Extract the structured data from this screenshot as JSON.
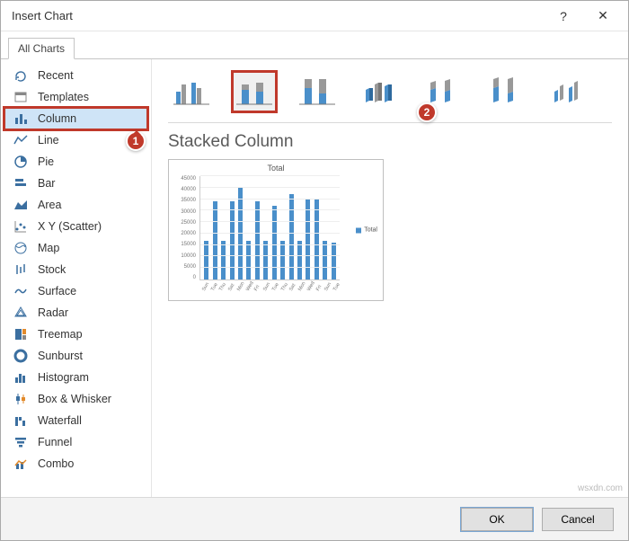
{
  "title": "Insert Chart",
  "tabs": {
    "all_charts": "All Charts"
  },
  "sidebar": {
    "items": [
      {
        "label": "Recent"
      },
      {
        "label": "Templates"
      },
      {
        "label": "Column"
      },
      {
        "label": "Line"
      },
      {
        "label": "Pie"
      },
      {
        "label": "Bar"
      },
      {
        "label": "Area"
      },
      {
        "label": "X Y (Scatter)"
      },
      {
        "label": "Map"
      },
      {
        "label": "Stock"
      },
      {
        "label": "Surface"
      },
      {
        "label": "Radar"
      },
      {
        "label": "Treemap"
      },
      {
        "label": "Sunburst"
      },
      {
        "label": "Histogram"
      },
      {
        "label": "Box & Whisker"
      },
      {
        "label": "Waterfall"
      },
      {
        "label": "Funnel"
      },
      {
        "label": "Combo"
      }
    ],
    "selected_index": 2
  },
  "subtype_row": {
    "selected_index": 1,
    "names": [
      "clustered-column",
      "stacked-column",
      "100-stacked-column",
      "3d-clustered-column",
      "3d-stacked-column",
      "3d-100-stacked-column",
      "3d-column"
    ]
  },
  "preview": {
    "heading": "Stacked Column",
    "chart_title": "Total",
    "legend": "Total"
  },
  "chart_data": {
    "type": "bar",
    "title": "Total",
    "ylabel": "",
    "xlabel": "",
    "ylim": [
      0,
      45000
    ],
    "yticks": [
      0,
      5000,
      10000,
      15000,
      20000,
      25000,
      30000,
      35000,
      40000,
      45000
    ],
    "categories": [
      "Sun",
      "Tue",
      "Thu",
      "Sat",
      "Mon",
      "Wed",
      "Fri",
      "Sun",
      "Tue",
      "Thu",
      "Sat",
      "Mon",
      "Wed",
      "Fri",
      "Sun",
      "Tue"
    ],
    "values": [
      17000,
      34000,
      17000,
      34000,
      40000,
      17000,
      34000,
      17000,
      32000,
      17000,
      37000,
      17000,
      35000,
      35000,
      17000,
      16000
    ],
    "series": [
      {
        "name": "Total"
      }
    ]
  },
  "footer": {
    "ok": "OK",
    "cancel": "Cancel"
  },
  "titlebar": {
    "help": "?",
    "close": "✕"
  },
  "annotations": {
    "marker1": "1",
    "marker2": "2"
  },
  "watermark": "wsxdn.com"
}
